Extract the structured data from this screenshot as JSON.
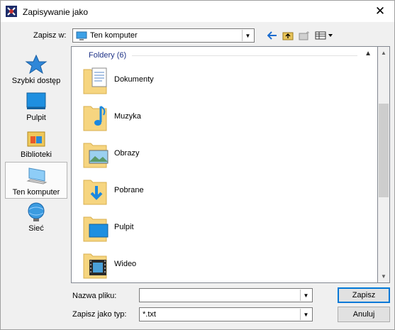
{
  "window": {
    "title": "Zapisywanie jako",
    "close_glyph": "✕"
  },
  "header": {
    "save_in_label": "Zapisz w:",
    "location_value": "Ten komputer"
  },
  "sidebar": {
    "items": [
      {
        "label": "Szybki dostęp",
        "icon": "star-icon"
      },
      {
        "label": "Pulpit",
        "icon": "desktop-icon"
      },
      {
        "label": "Biblioteki",
        "icon": "libraries-icon"
      },
      {
        "label": "Ten komputer",
        "icon": "computer-icon",
        "selected": true
      },
      {
        "label": "Sieć",
        "icon": "network-icon"
      }
    ]
  },
  "list": {
    "group_header": "Foldery (6)",
    "folders": [
      {
        "name": "Dokumenty",
        "icon": "documents-folder-icon"
      },
      {
        "name": "Muzyka",
        "icon": "music-folder-icon"
      },
      {
        "name": "Obrazy",
        "icon": "pictures-folder-icon"
      },
      {
        "name": "Pobrane",
        "icon": "downloads-folder-icon"
      },
      {
        "name": "Pulpit",
        "icon": "desktop-folder-icon"
      },
      {
        "name": "Wideo",
        "icon": "videos-folder-icon"
      }
    ]
  },
  "footer": {
    "filename_label": "Nazwa pliku:",
    "filename_value": "",
    "filetype_label": "Zapisz jako typ:",
    "filetype_value": "*.txt",
    "save_button": "Zapisz",
    "cancel_button": "Anuluj"
  },
  "colors": {
    "accent": "#0078d7",
    "group_header": "#1e3287",
    "folder": "#f6d580"
  }
}
